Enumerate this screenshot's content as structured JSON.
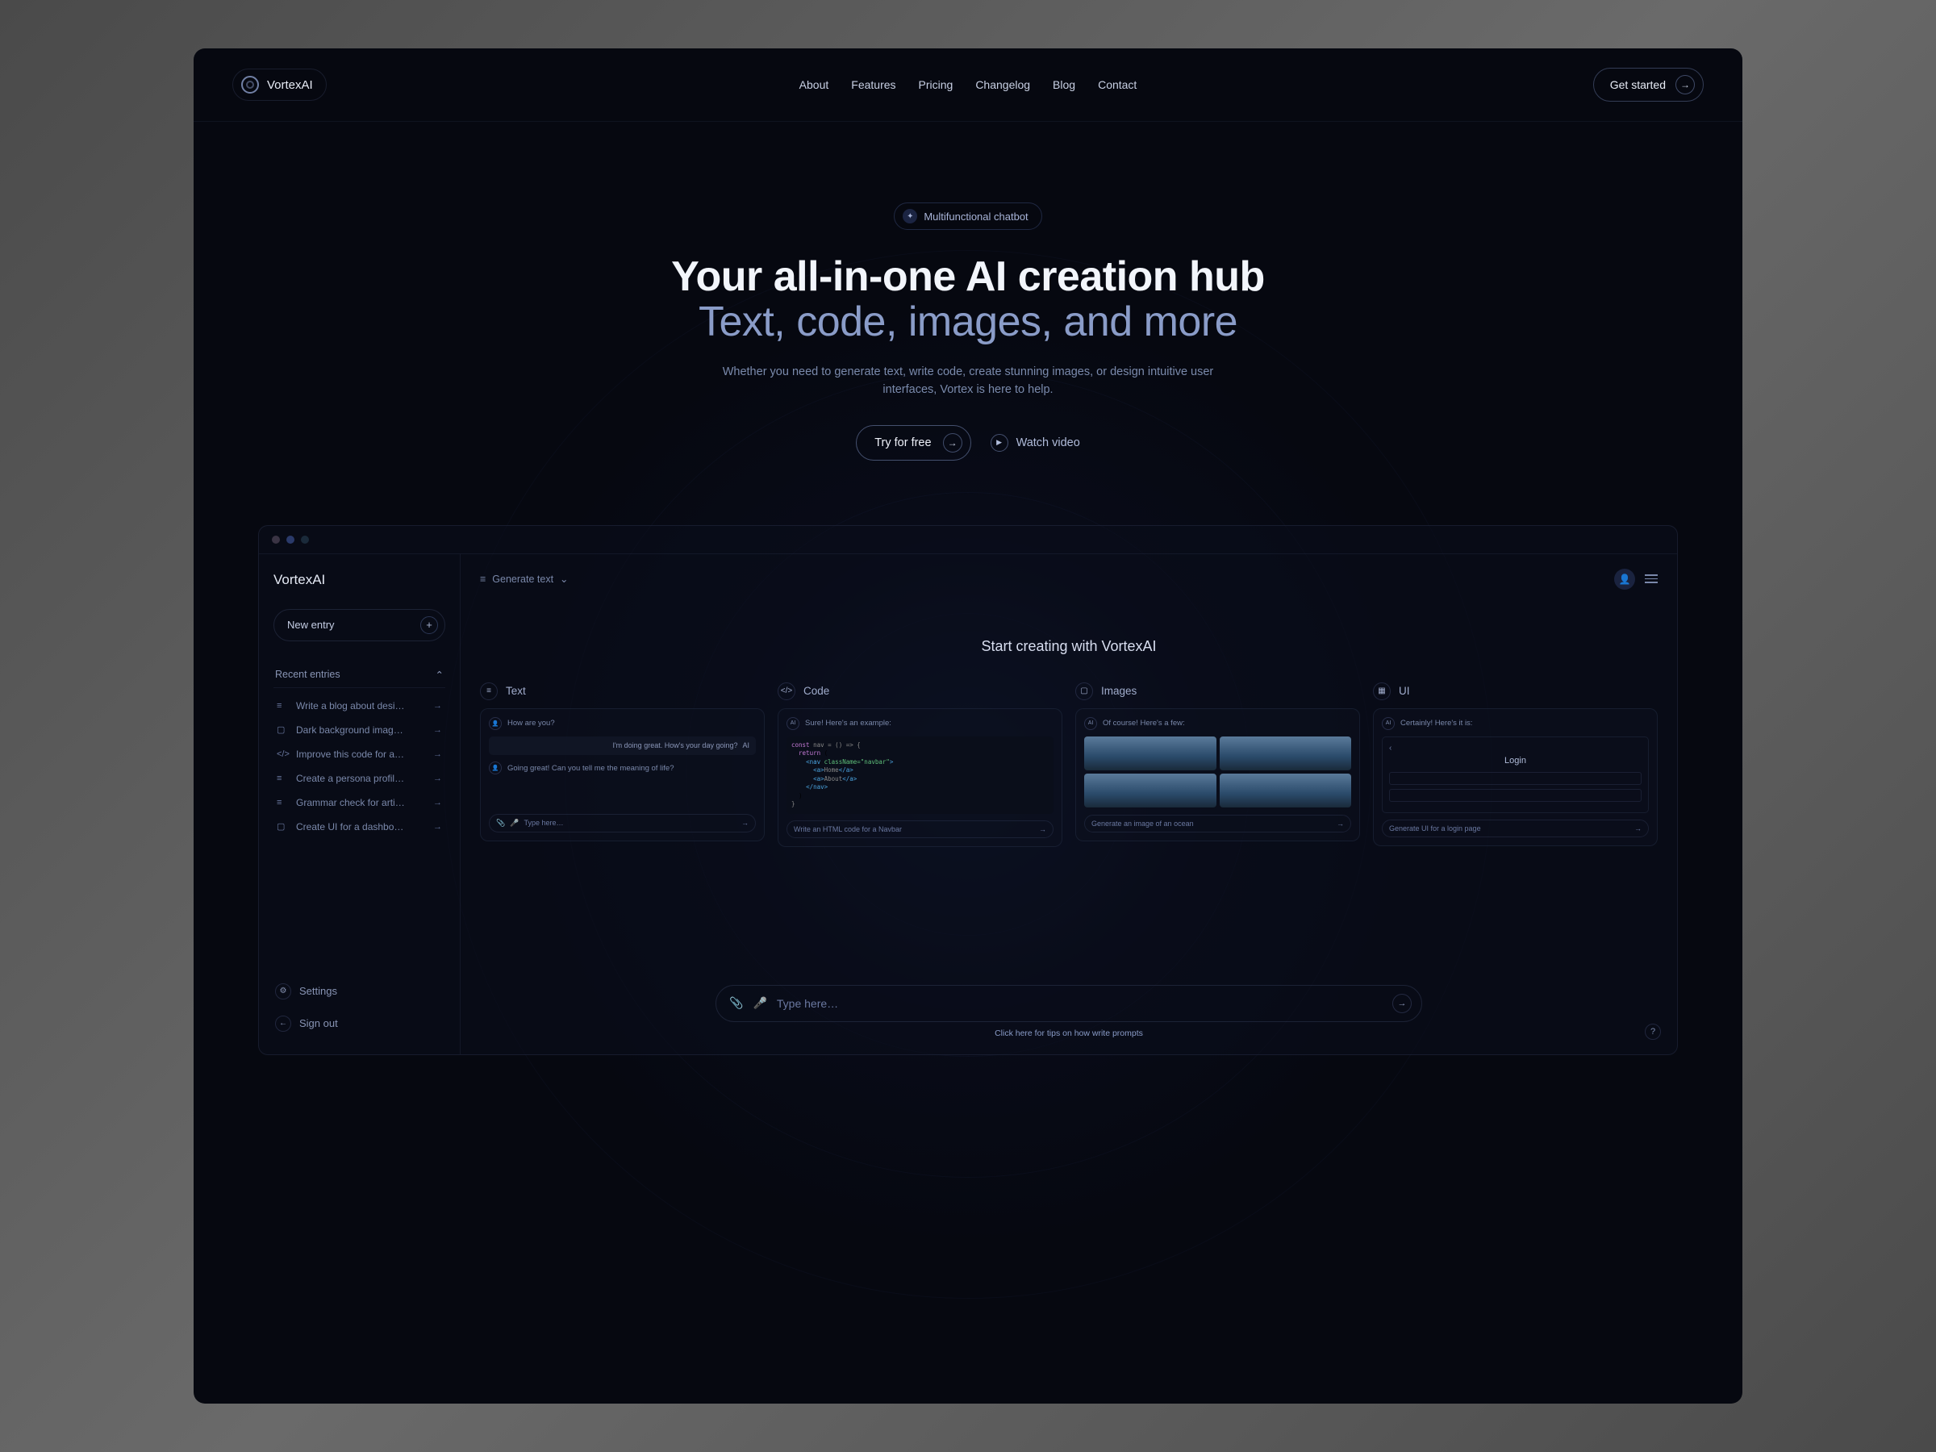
{
  "brand": "VortexAI",
  "nav": {
    "about": "About",
    "features": "Features",
    "pricing": "Pricing",
    "changelog": "Changelog",
    "blog": "Blog",
    "contact": "Contact"
  },
  "cta": "Get started",
  "hero": {
    "badge": "Multifunctional chatbot",
    "title": "Your all-in-one AI creation hub",
    "subtitle": "Text, code, images, and more",
    "desc": "Whether you need to generate text, write code, create stunning images, or design intuitive user interfaces, Vortex is here to help.",
    "primary": "Try for free",
    "secondary": "Watch video"
  },
  "app": {
    "brand": "VortexAI",
    "mode": "Generate text",
    "new_entry": "New entry",
    "recent_hdr": "Recent entries",
    "entries": [
      {
        "icon": "≡",
        "label": "Write a blog about desi…"
      },
      {
        "icon": "▢",
        "label": "Dark background imag…"
      },
      {
        "icon": "</>",
        "label": "Improve this code for a…"
      },
      {
        "icon": "≡",
        "label": "Create a persona profil…"
      },
      {
        "icon": "≡",
        "label": "Grammar check for arti…"
      },
      {
        "icon": "▢",
        "label": "Create UI for a dashbo…"
      }
    ],
    "settings": "Settings",
    "signout": "Sign out",
    "title": "Start creating with VortexAI",
    "cards": {
      "text": {
        "hdr": "Text",
        "msg1": "How are you?",
        "msg2": "I'm doing great. How's your day going?",
        "msg3": "Going great! Can you tell me the meaning of life?",
        "input": "Type here…"
      },
      "code": {
        "hdr": "Code",
        "msg1": "Sure! Here's an example:",
        "input": "Write an HTML code for a Navbar"
      },
      "images": {
        "hdr": "Images",
        "msg1": "Of course! Here's a few:",
        "input": "Generate an image of an ocean"
      },
      "ui": {
        "hdr": "UI",
        "msg1": "Certainly! Here's it is:",
        "login_title": "Login",
        "input": "Generate UI for a login page"
      }
    },
    "composer": "Type here…",
    "tip_pre": "Click ",
    "tip_link": "here",
    "tip_post": " for tips on how write prompts"
  }
}
